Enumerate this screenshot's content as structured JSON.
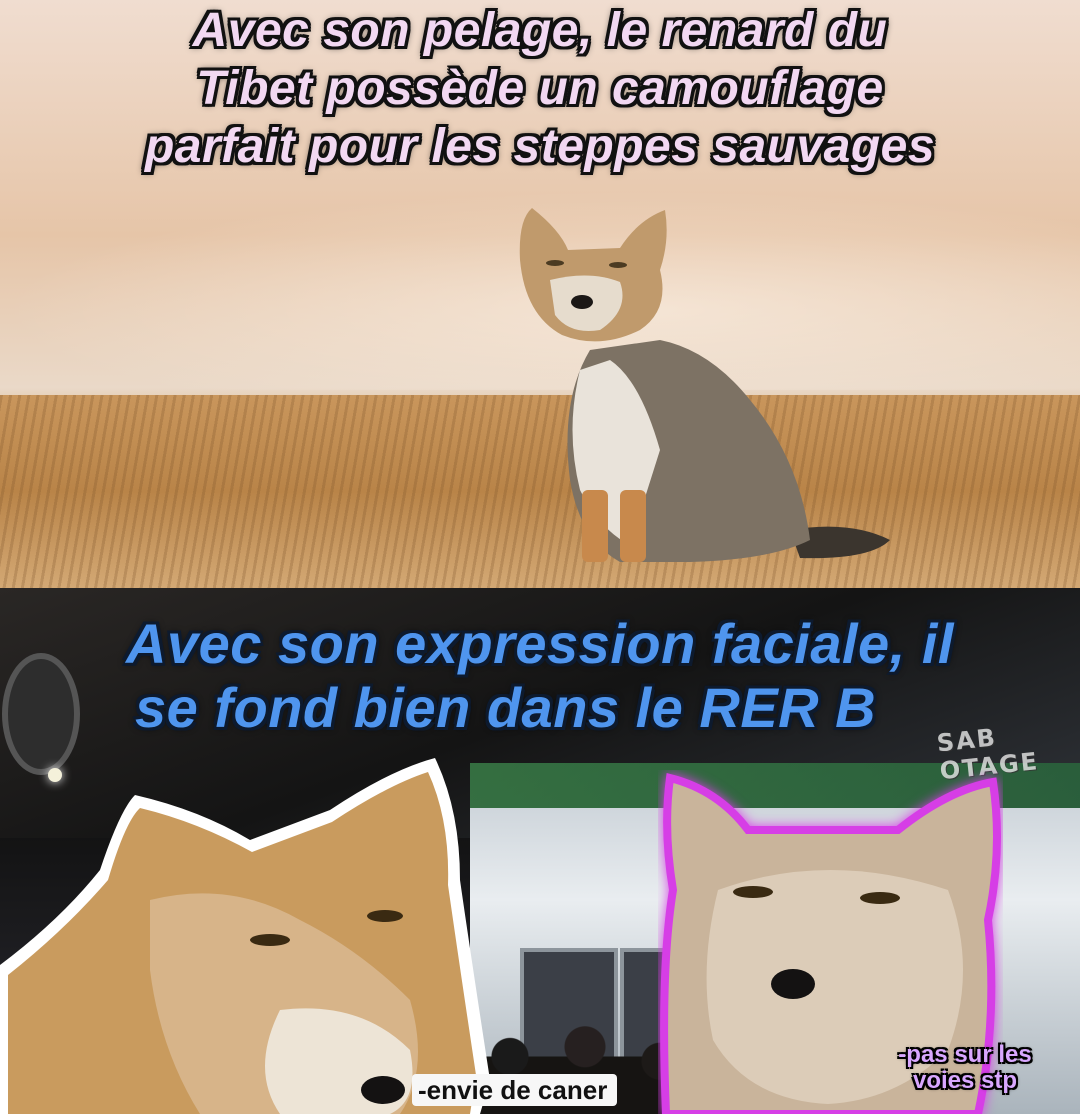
{
  "top_caption": {
    "line1": "Avec son pelage, le renard du",
    "line2": "Tibet possède un camouflage",
    "line3": "parfait pour les steppes sauvages"
  },
  "bottom_caption": {
    "line1": "Avec son expression faciale, il",
    "line2": "se fond bien dans le RER B"
  },
  "watermark": "SAB OTAGE",
  "left_fox_label": "-envie de caner",
  "right_fox_label": "-pas sur les voies stp",
  "colors": {
    "top_caption": "#f2d8f2",
    "bottom_caption": "#4f95ee",
    "right_outline": "#d63ee6",
    "left_outline": "#ffffff"
  }
}
